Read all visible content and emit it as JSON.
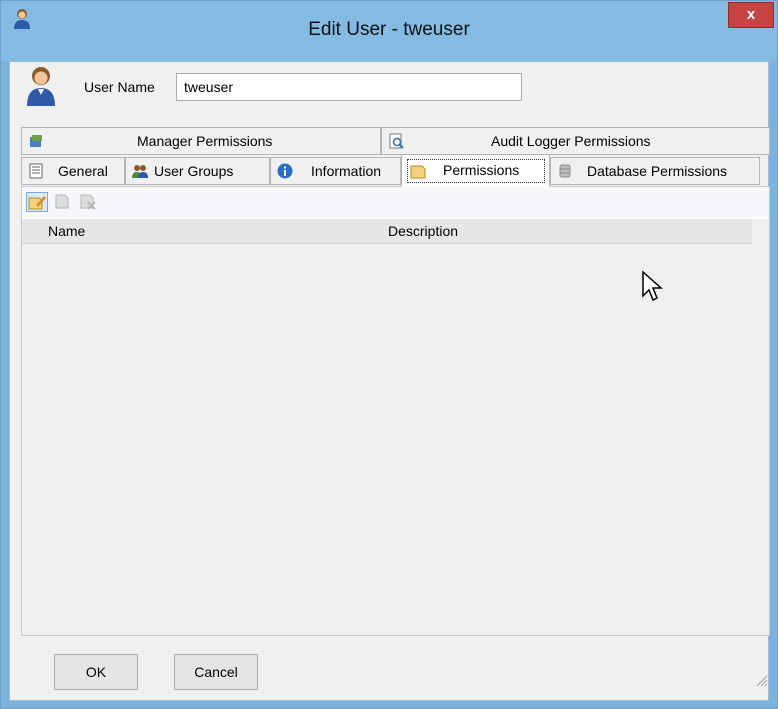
{
  "window": {
    "title": "Edit User - tweuser",
    "close_label": "x"
  },
  "user": {
    "label": "User Name",
    "value": "tweuser"
  },
  "tabs_row_back": [
    {
      "label": "Manager Permissions",
      "icon": "manager-permissions-icon"
    },
    {
      "label": "Audit Logger Permissions",
      "icon": "audit-logger-icon"
    }
  ],
  "tabs_row_front": [
    {
      "label": "General",
      "icon": "general-icon"
    },
    {
      "label": "User Groups",
      "icon": "user-groups-icon"
    },
    {
      "label": "Information",
      "icon": "information-icon"
    },
    {
      "label": "Permissions",
      "icon": "permissions-icon",
      "active": true
    },
    {
      "label": "Database Permissions",
      "icon": "database-icon"
    }
  ],
  "toolbar": {
    "buttons": [
      "add-permission-icon",
      "edit-permission-icon",
      "delete-permission-icon"
    ]
  },
  "grid": {
    "columns": [
      "Name",
      "Description"
    ],
    "rows": []
  },
  "buttons": {
    "ok": "OK",
    "cancel": "Cancel"
  },
  "colors": {
    "titlebar": "#83bbe3",
    "close": "#c74343",
    "accent_border": "#7aa9d6"
  }
}
